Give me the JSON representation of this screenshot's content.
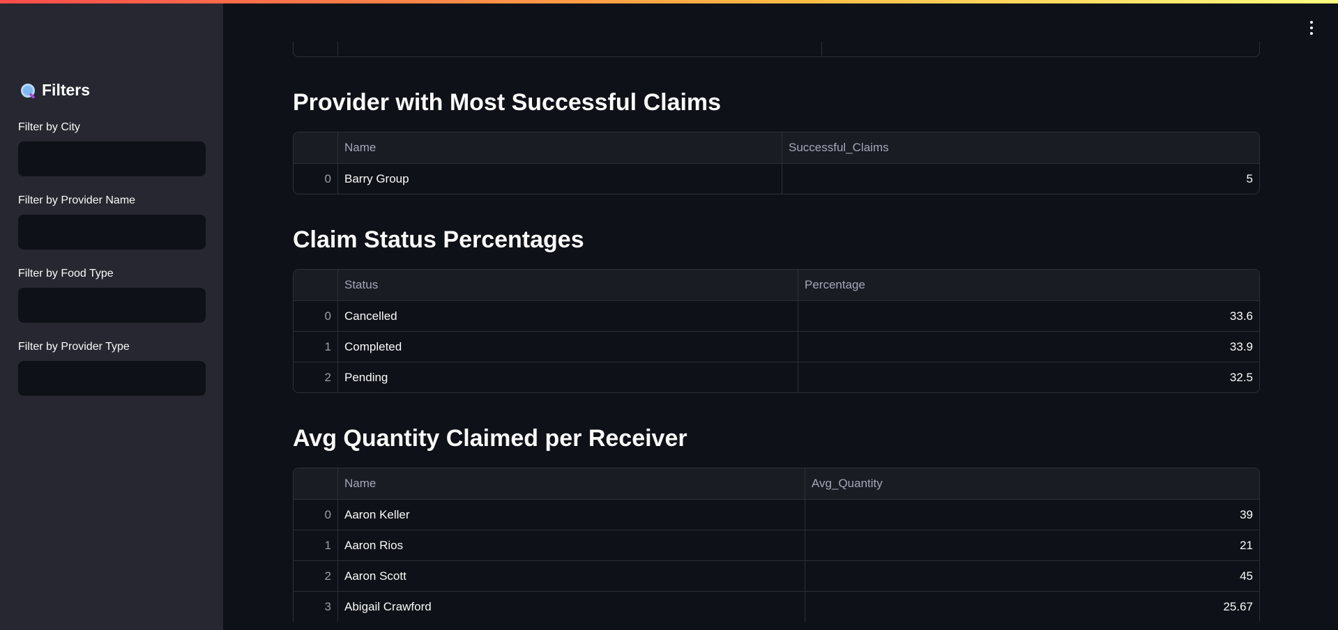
{
  "sidebar": {
    "title": "Filters",
    "filters": [
      {
        "label": "Filter by City",
        "value": ""
      },
      {
        "label": "Filter by Provider Name",
        "value": ""
      },
      {
        "label": "Filter by Food Type",
        "value": ""
      },
      {
        "label": "Filter by Provider Type",
        "value": ""
      }
    ]
  },
  "sections": [
    {
      "title": "Provider with Most Successful Claims",
      "columns": [
        "Name",
        "Successful_Claims"
      ],
      "rows": [
        {
          "index": "0",
          "name": "Barry Group",
          "value": "5"
        }
      ]
    },
    {
      "title": "Claim Status Percentages",
      "columns": [
        "Status",
        "Percentage"
      ],
      "rows": [
        {
          "index": "0",
          "name": "Cancelled",
          "value": "33.6"
        },
        {
          "index": "1",
          "name": "Completed",
          "value": "33.9"
        },
        {
          "index": "2",
          "name": "Pending",
          "value": "32.5"
        }
      ]
    },
    {
      "title": "Avg Quantity Claimed per Receiver",
      "columns": [
        "Name",
        "Avg_Quantity"
      ],
      "rows": [
        {
          "index": "0",
          "name": "Aaron Keller",
          "value": "39"
        },
        {
          "index": "1",
          "name": "Aaron Rios",
          "value": "21"
        },
        {
          "index": "2",
          "name": "Aaron Scott",
          "value": "45"
        },
        {
          "index": "3",
          "name": "Abigail Crawford",
          "value": "25.67"
        }
      ]
    }
  ]
}
